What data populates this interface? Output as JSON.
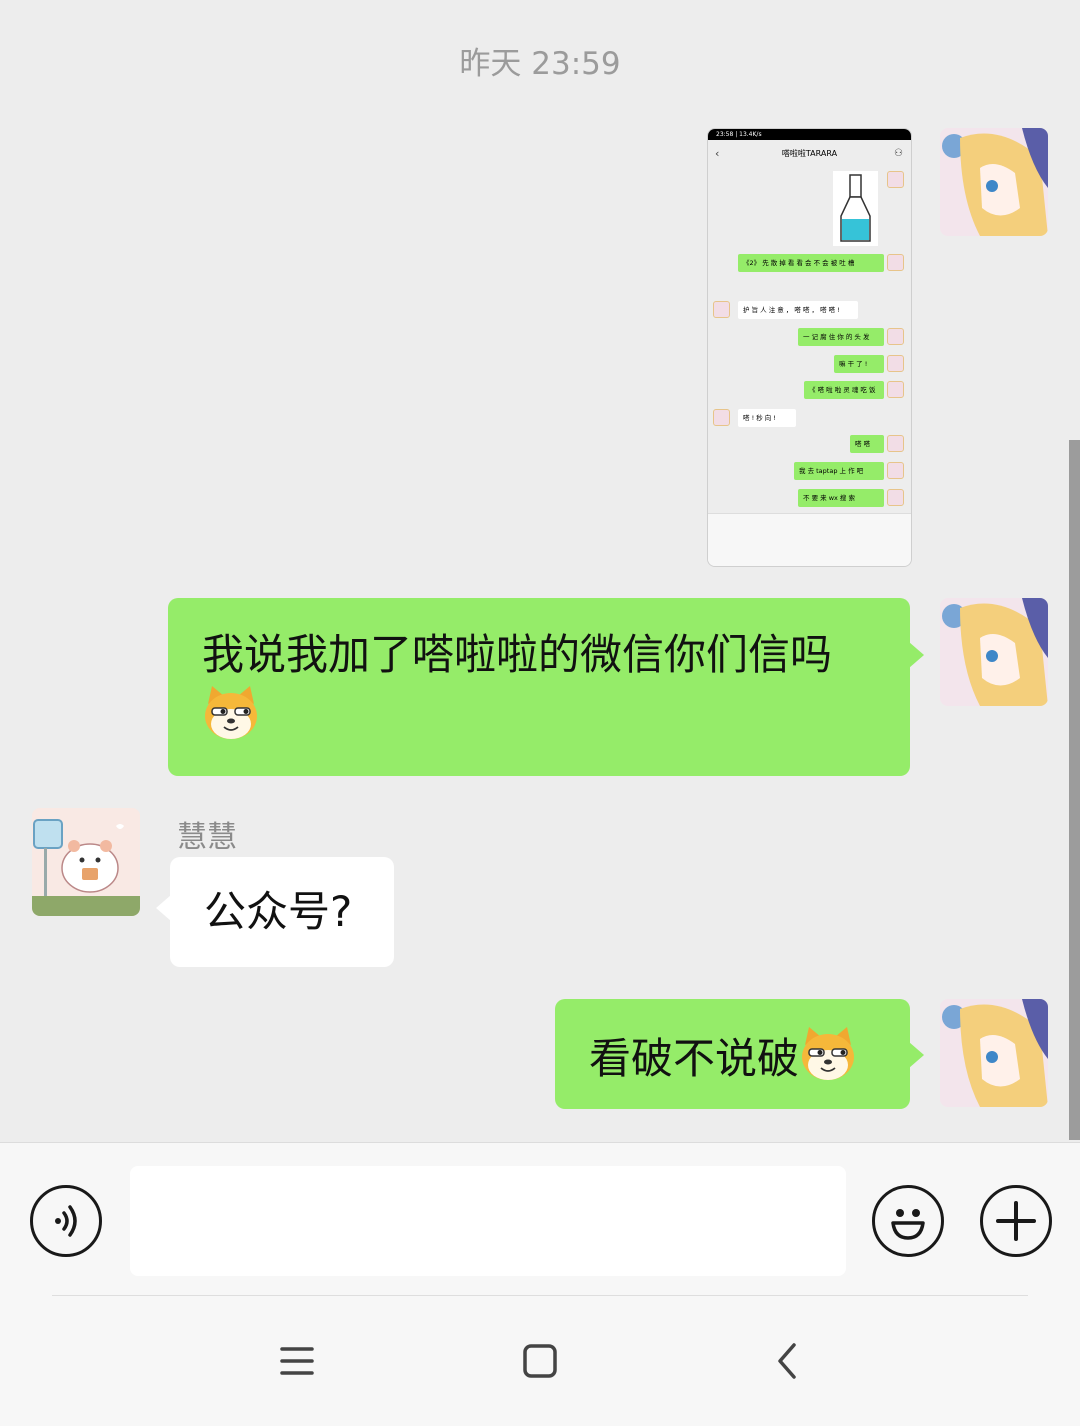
{
  "timestamp": "昨天 23:59",
  "thumbnail": {
    "status_bar": "23:58 | 13.4K/s",
    "chat_title": "嗒啦啦TARARA",
    "rows": [
      {
        "side": "me",
        "text": "《2》 先 散 掉 看 看 会 不 会 被 吐 槽"
      },
      {
        "side": "other",
        "text": "护 旨 人 注 意 ， 嗒 嗒 ， 嗒 嗒 !"
      },
      {
        "side": "me",
        "text": "一 记 腐 住 你 的 头 发"
      },
      {
        "side": "me",
        "text": "嘛 干 了 !"
      },
      {
        "side": "me",
        "text": "《 嗒 啦 啦 灵 魂 吃 饭"
      },
      {
        "side": "other",
        "text": "嗒 ! 秒 向 !"
      },
      {
        "side": "me",
        "text": "嗒 嗒"
      },
      {
        "side": "me",
        "text": "我 去 taptap 上 作 吧"
      },
      {
        "side": "me",
        "text": "不 要 来 wx 搜 索"
      }
    ]
  },
  "messages": [
    {
      "sender": "me",
      "text": "我说我加了嗒啦啦的微信你们信吗",
      "emoji": "dog-face-emoji"
    },
    {
      "sender": "慧慧",
      "text": "公众号?"
    },
    {
      "sender": "me",
      "text": "看破不说破",
      "emoji": "dog-face-emoji"
    }
  ],
  "input_bar": {
    "voice_icon": "voice-icon",
    "emoji_icon": "smiley-icon",
    "plus_icon": "plus-icon",
    "input_value": ""
  },
  "nav_bar": {
    "menu_icon": "menu-icon",
    "home_icon": "home-icon",
    "back_icon": "back-icon"
  },
  "colors": {
    "background": "#ededed",
    "my_bubble": "#95ec69",
    "other_bubble": "#ffffff"
  }
}
